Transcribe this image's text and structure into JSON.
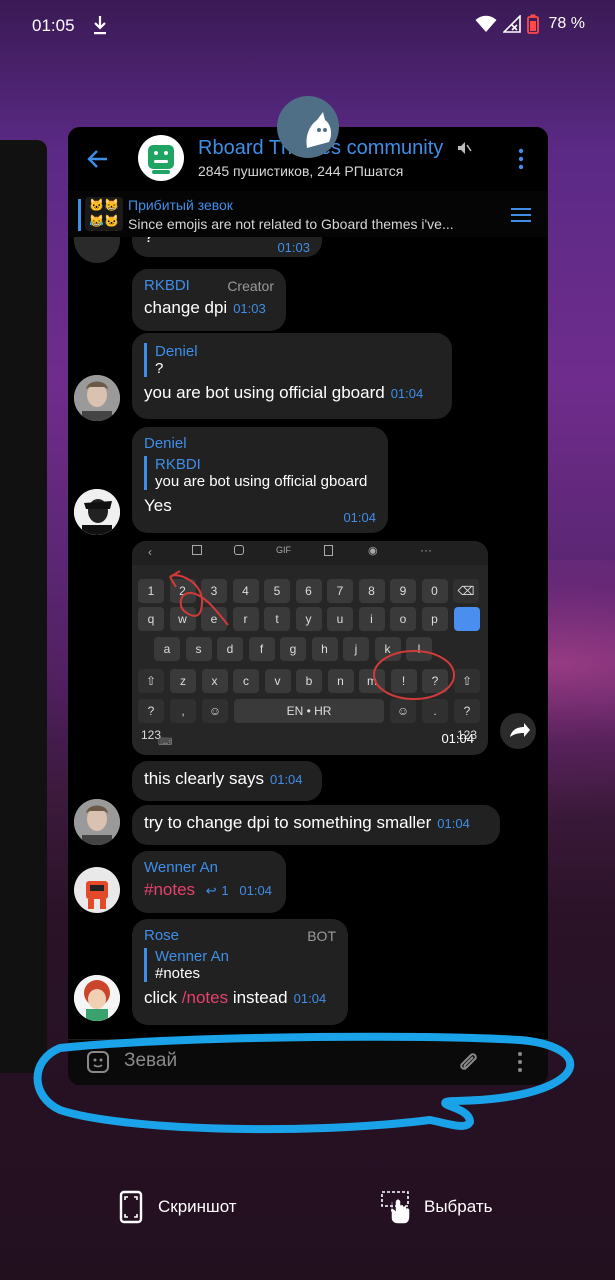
{
  "status_bar": {
    "time": "01:05",
    "battery_percent": "78 %"
  },
  "chat": {
    "title": "Rboard Themes community",
    "subtitle": "2845 пушистиков, 244 РПшатся",
    "pinned": {
      "title": "Прибитый зевок",
      "text": "Since emojis are not related to Gboard themes i've...",
      "thumb_emoji": "🐱😸😹🐱😼😸"
    },
    "input_placeholder": "Зевай"
  },
  "messages": [
    {
      "id": "m0",
      "text": "?",
      "time": "01:03"
    },
    {
      "id": "m1",
      "sender": "RKBDI",
      "role": "Creator",
      "text": "change dpi",
      "time": "01:03"
    },
    {
      "id": "m2",
      "quote_name": "Deniel",
      "quote_text": "?",
      "text": "you are bot using official gboard",
      "time": "01:04"
    },
    {
      "id": "m3",
      "sender": "Deniel",
      "quote_name": "RKBDI",
      "quote_text": "you are bot using official gboard",
      "text": "Yes",
      "time": "01:04"
    },
    {
      "id": "m4",
      "time": "01:04",
      "keyboard": {
        "row1": [
          "1",
          "2",
          "3",
          "4",
          "5",
          "6",
          "7",
          "8",
          "9",
          "0"
        ],
        "row2": [
          "q",
          "w",
          "e",
          "r",
          "t",
          "y",
          "u",
          "i",
          "o",
          "p"
        ],
        "row3": [
          "a",
          "s",
          "d",
          "f",
          "g",
          "h",
          "j",
          "k",
          "l"
        ],
        "row4": [
          "z",
          "x",
          "c",
          "v",
          "b",
          "n",
          "m",
          "!",
          "?"
        ],
        "space_label": "EN • HR",
        "sym_label": "?123",
        "toolbar_gif": "GIF"
      }
    },
    {
      "id": "m5",
      "text": "this clearly says",
      "time": "01:04"
    },
    {
      "id": "m6",
      "text": "try to change dpi to something smaller",
      "time": "01:04"
    },
    {
      "id": "m7",
      "sender": "Wenner An",
      "text": "#notes",
      "reply_count": "1",
      "time": "01:04"
    },
    {
      "id": "m8",
      "sender": "Rose",
      "role": "BOT",
      "quote_name": "Wenner An",
      "quote_text": "#notes",
      "text_pre": "click ",
      "text_link": "/notes",
      "text_post": " instead",
      "time": "01:04"
    }
  ],
  "bottom_actions": {
    "screenshot_label": "Скриншот",
    "select_label": "Выбрать"
  },
  "colors": {
    "accent": "#3f8ee8",
    "bubble": "#212121",
    "link_pink": "#e5416c",
    "scribble": "#1aa3e8"
  }
}
